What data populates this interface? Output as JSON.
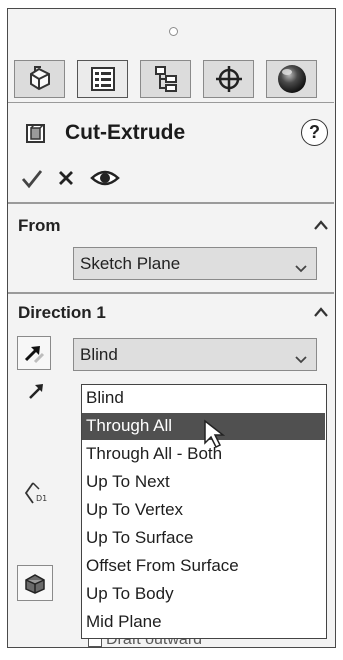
{
  "feature": {
    "title": "Cut-Extrude",
    "help": "?"
  },
  "tabs": [
    {
      "name": "featuremanager-tab",
      "icon": "feature-tree-icon"
    },
    {
      "name": "propertymanager-tab",
      "icon": "property-list-icon"
    },
    {
      "name": "configurationmanager-tab",
      "icon": "configuration-icon"
    },
    {
      "name": "dimxpertmanager-tab",
      "icon": "crosshair-icon"
    },
    {
      "name": "displaymanager-tab",
      "icon": "appearance-sphere-icon"
    }
  ],
  "actions": [
    {
      "name": "ok-button",
      "icon": "checkmark-icon"
    },
    {
      "name": "cancel-button",
      "icon": "close-icon"
    },
    {
      "name": "preview-button",
      "icon": "eye-icon"
    }
  ],
  "from": {
    "title": "From",
    "selected": "Sketch Plane"
  },
  "direction1": {
    "title": "Direction 1",
    "selected": "Blind",
    "options": [
      "Blind",
      "Through All",
      "Through All - Both",
      "Up To Next",
      "Up To Vertex",
      "Up To Surface",
      "Offset From Surface",
      "Up To Body",
      "Mid Plane"
    ],
    "highlighted_index": 1,
    "draft_label": "Draft outward"
  }
}
